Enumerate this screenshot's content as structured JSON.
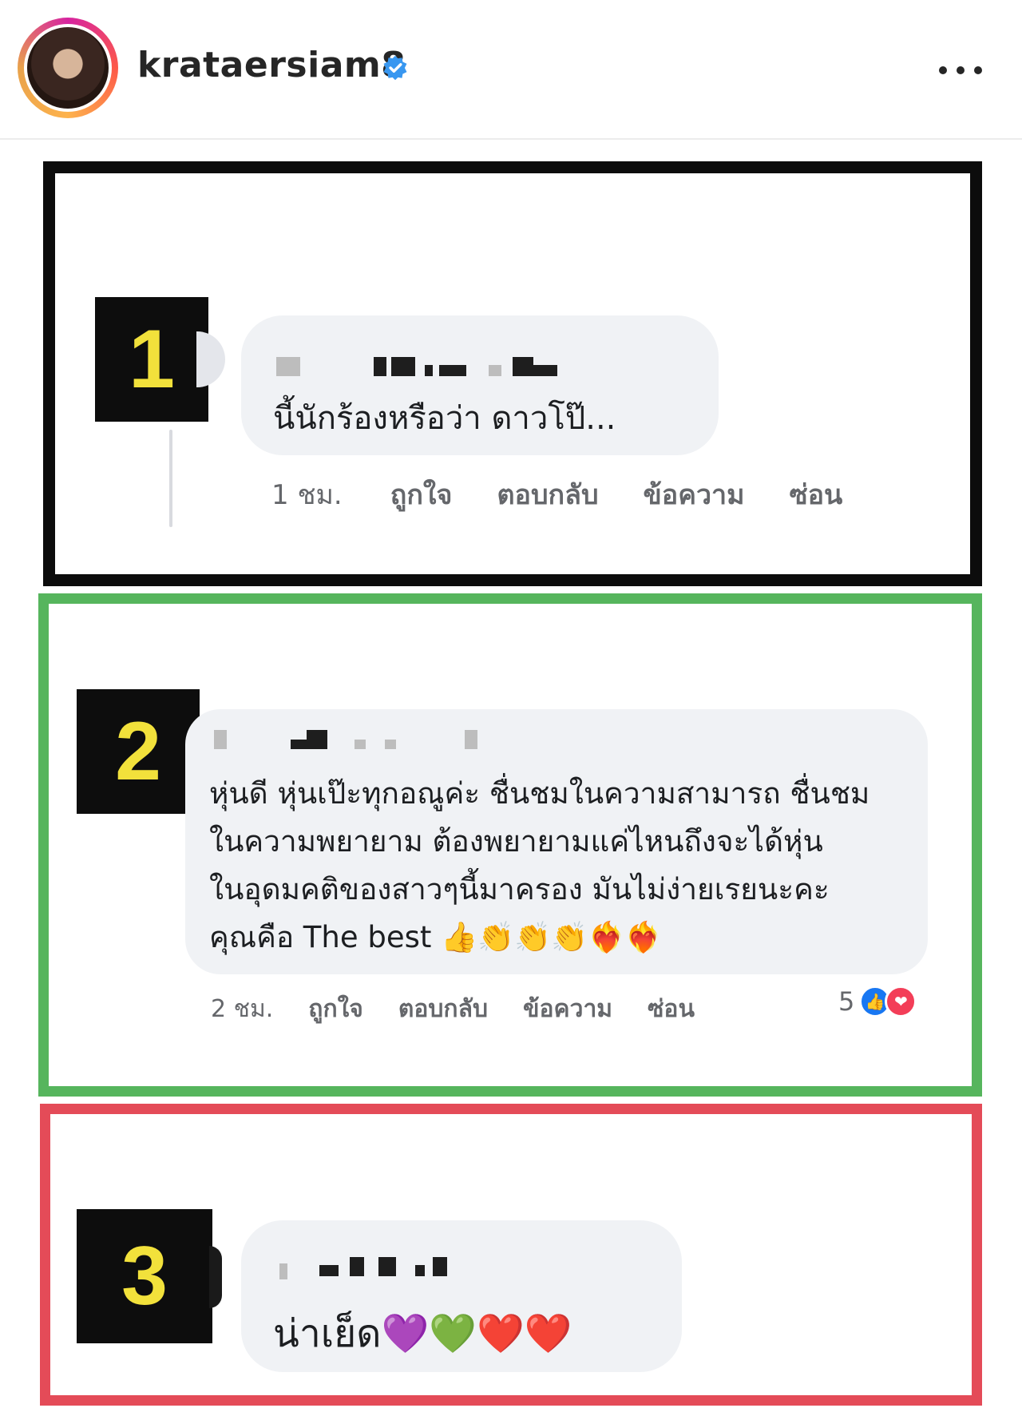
{
  "header": {
    "username": "krataersiam8"
  },
  "panels": [
    {
      "number": "1",
      "frame_color": "#0c0c0c",
      "comment_text": "นี้นักร้องหรือว่า ดาวโป๊...",
      "time": "1 ชม.",
      "actions": [
        "ถูกใจ",
        "ตอบกลับ",
        "ข้อความ",
        "ซ่อน"
      ]
    },
    {
      "number": "2",
      "frame_color": "#56b55d",
      "comment_lines": [
        "หุ่นดี หุ่นเป๊ะทุกอณูค่ะ ชื่นชมในความสามารถ ชื่นชม",
        "ในความพยายาม ต้องพยายามแค่ไหนถึงจะได้หุ่น",
        "ในอุดมคติของสาวๆนี้มาครอง มันไม่ง่ายเรยนะคะ",
        "คุณคือ The best 👍👏👏👏❤️‍🔥❤️‍🔥"
      ],
      "time": "2 ชม.",
      "actions": [
        "ถูกใจ",
        "ตอบกลับ",
        "ข้อความ",
        "ซ่อน"
      ],
      "reaction_count": "5"
    },
    {
      "number": "3",
      "frame_color": "#e44b58",
      "comment_text": "น่าเย็ด💜💚❤️❤️"
    }
  ],
  "colors": {
    "badge_bg": "#0d0d0d",
    "badge_text": "#f2e13b",
    "bubble_bg": "#f0f2f5",
    "verified": "#3897f0"
  }
}
